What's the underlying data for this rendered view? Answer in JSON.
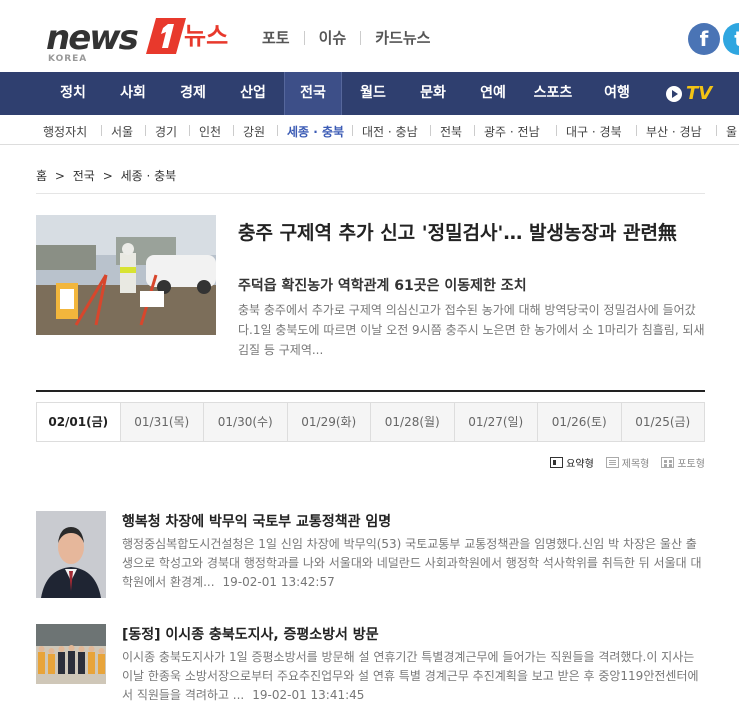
{
  "header": {
    "logo_main": "news",
    "logo_ko": "뉴스",
    "logo_sub": "KOREA",
    "topnav": [
      "포토",
      "이슈",
      "카드뉴스"
    ],
    "social": {
      "facebook": "f",
      "twitter": "t"
    }
  },
  "mainnav": {
    "items": [
      "정치",
      "사회",
      "경제",
      "산업",
      "전국",
      "월드",
      "문화",
      "연예",
      "스포츠",
      "여행"
    ],
    "active": "전국",
    "tv_label": "TV"
  },
  "subnav": {
    "items": [
      "행정자치",
      "서울",
      "경기",
      "인천",
      "강원",
      "세종 · 충북",
      "대전 · 충남",
      "전북",
      "광주 · 전남",
      "대구 · 경북",
      "부산 · 경남",
      "울"
    ],
    "active": "세종 · 충북"
  },
  "breadcrumb": [
    "홈",
    ">",
    "전국",
    ">",
    "세종 · 충북"
  ],
  "top_story": {
    "title": "충주 구제역 추가 신고 '정밀검사'… 발생농장과 관련無",
    "subtitle": "주덕읍 확진농가 역학관계 61곳은 이동제한 조치",
    "body": "충북 충주에서 추가로 구제역 의심신고가 접수된 농가에 대해 방역당국이 정밀검사에 들어갔다.1일 충북도에 따르면 이날 오전 9시쯤 충주시 노은면 한 농가에서 소 1마리가 침흘림, 되새김질 등 구제역..."
  },
  "date_tabs": [
    "02/01(금)",
    "01/31(목)",
    "01/30(수)",
    "01/29(화)",
    "01/28(월)",
    "01/27(일)",
    "01/26(토)",
    "01/25(금)"
  ],
  "view_options": [
    "요약형",
    "제목형",
    "포토형"
  ],
  "articles": [
    {
      "title": "행복청 차장에 박무익 국토부 교통정책관 임명",
      "body": "행정중심복합도시건설청은 1일 신임 차장에 박무익(53) 국토교통부 교통정책관을 임명했다.신임 박 차장은 울산 출생으로 학성고와 경북대 행정학과를 나와 서울대와 네덜란드 사회과학원에서 행정학 석사학위를 취득한 뒤 서울대 대학원에서 환경계...",
      "date": "19-02-01 13:42:57"
    },
    {
      "title": "[동정] 이시종 충북도지사, 증평소방서 방문",
      "body": "이시종 충북도지사가 1일 증평소방서를 방문해 설 연휴기간 특별경계근무에 들어가는 직원들을 격려했다.이 지사는 이날 한종욱 소방서장으로부터 주요추진업무와 설 연휴 특별 경계근무 추진계획을 보고 받은 후 중앙119안전센터에서 직원들을 격려하고 ...",
      "date": "19-02-01 13:41:45"
    }
  ]
}
